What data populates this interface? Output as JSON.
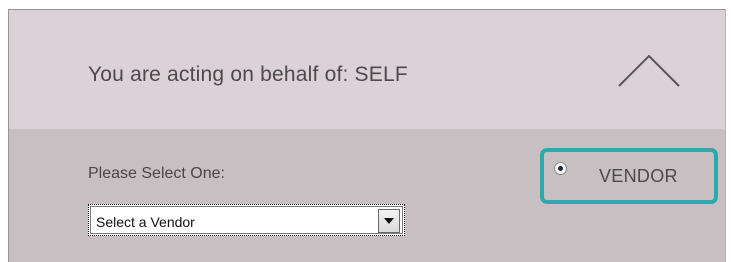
{
  "header": {
    "title": "You are acting on behalf of: SELF",
    "collapse_icon": "chevron-up-icon"
  },
  "selection": {
    "prompt_label": "Please Select One:",
    "vendor_select": {
      "value": "Select a Vendor",
      "arrow_icon": "chevron-down-icon"
    },
    "vendor_radio": {
      "label": "VENDOR",
      "checked": true
    }
  },
  "colors": {
    "header_bg": "#dcd1d6",
    "body_bg": "#c8bfc3",
    "highlight_border": "#2ea8ad"
  }
}
